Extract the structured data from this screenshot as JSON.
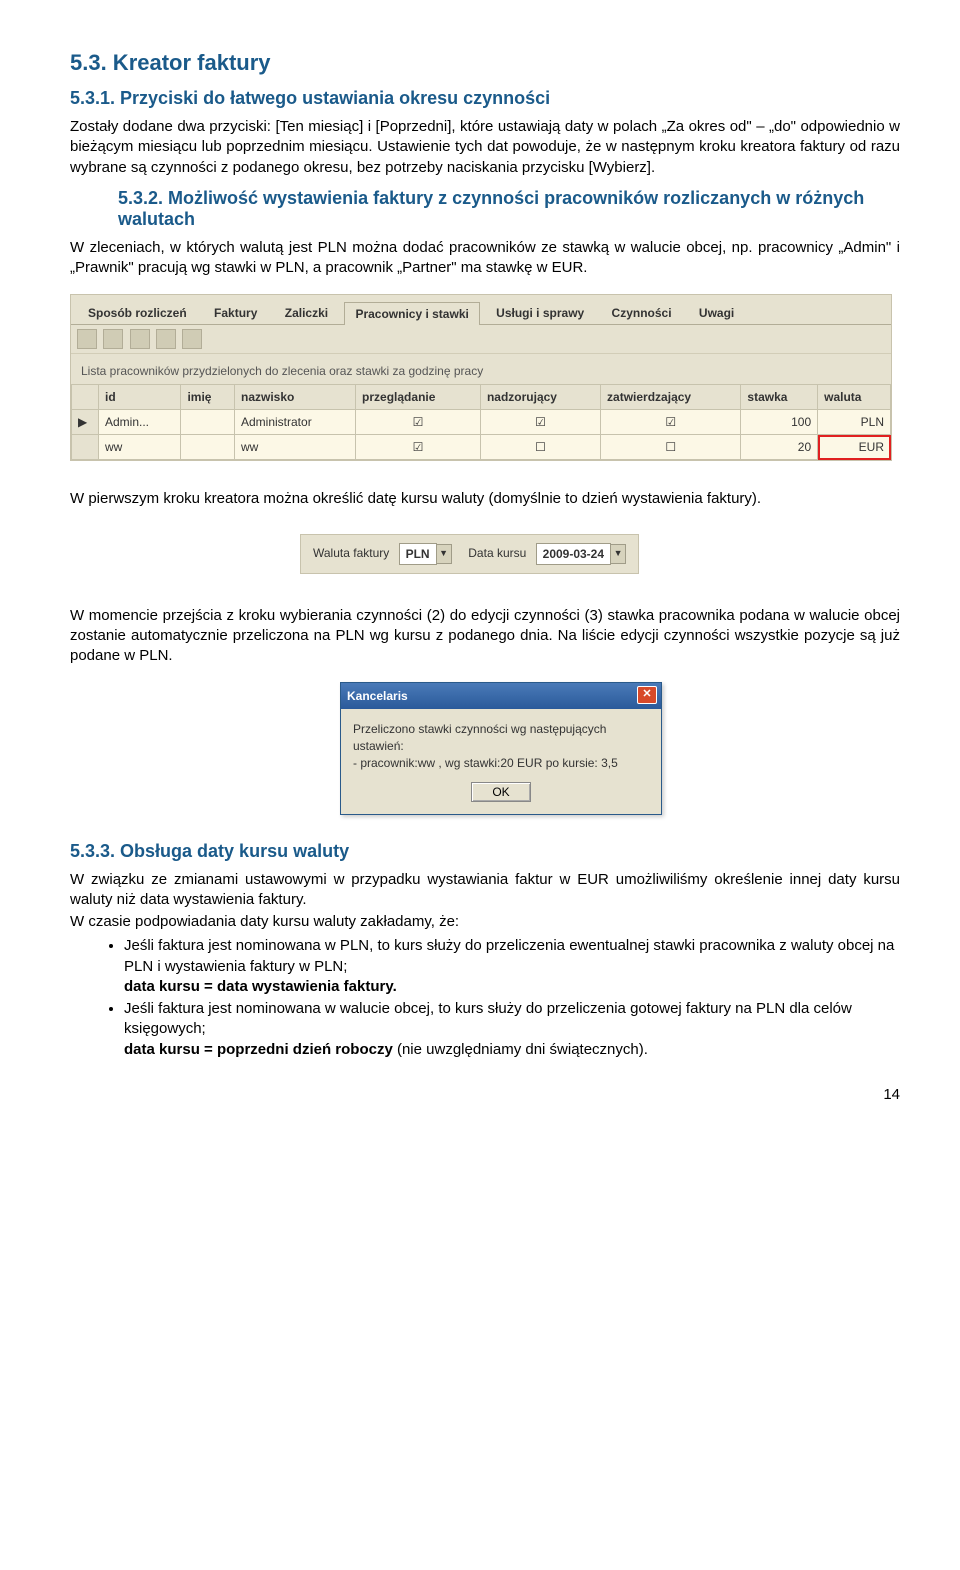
{
  "h_53": "5.3. Kreator faktury",
  "h_531": "5.3.1. Przyciski do łatwego ustawiania okresu czynności",
  "p_531": "Zostały dodane dwa przyciski: [Ten miesiąc] i [Poprzedni], które ustawiają daty w polach „Za okres od\" – „do\" odpowiednio w bieżącym miesiącu lub poprzednim miesiącu. Ustawienie tych dat powoduje, że w następnym kroku kreatora faktury od razu wybrane są czynności z podanego okresu, bez potrzeby naciskania przycisku [Wybierz].",
  "h_532": "5.3.2. Możliwość wystawienia faktury z czynności pracowników rozliczanych w różnych walutach",
  "p_532": "W zleceniach, w których walutą jest PLN można dodać pracowników ze stawką w walucie obcej, np. pracownicy „Admin\" i „Prawnik\" pracują wg stawki w PLN, a pracownik „Partner\" ma stawkę w EUR.",
  "panel1": {
    "tabs": [
      "Sposób rozliczeń",
      "Faktury",
      "Zaliczki",
      "Pracownicy i stawki",
      "Usługi i sprawy",
      "Czynności",
      "Uwagi"
    ],
    "active_tab": 3,
    "caption": "Lista pracowników przydzielonych do zlecenia oraz stawki za godzinę pracy",
    "columns": [
      "id",
      "imię",
      "nazwisko",
      "przeglądanie",
      "nadzorujący",
      "zatwierdzający",
      "stawka",
      "waluta"
    ],
    "rows": [
      {
        "id": "Admin...",
        "imie": "",
        "nazwisko": "Administrator",
        "przeg": true,
        "nadz": true,
        "zatw": true,
        "stawka": "100",
        "waluta": "PLN"
      },
      {
        "id": "ww",
        "imie": "",
        "nazwisko": "ww",
        "przeg": true,
        "nadz": false,
        "zatw": false,
        "stawka": "20",
        "waluta": "EUR"
      }
    ]
  },
  "p_after_panel1": "W pierwszym kroku kreatora można określić datę kursu waluty (domyślnie to dzień wystawienia faktury).",
  "panel2": {
    "label_currency": "Waluta faktury",
    "currency": "PLN",
    "label_date": "Data kursu",
    "date": "2009-03-24"
  },
  "p_after_panel2": "W momencie przejścia z kroku wybierania czynności (2) do edycji czynności (3) stawka pracownika podana w walucie obcej zostanie automatycznie przeliczona na PLN wg kursu z podanego dnia. Na liście edycji czynności wszystkie pozycje są już podane w PLN.",
  "dialog": {
    "title": "Kancelaris",
    "line1": "Przeliczono stawki czynności wg następujących ustawień:",
    "line2": "- pracownik:ww , wg stawki:20 EUR po kursie: 3,5",
    "ok": "OK"
  },
  "h_533": "5.3.3. Obsługa daty kursu waluty",
  "p_533a": "W związku ze zmianami ustawowymi w przypadku wystawiania faktur w EUR umożliwiliśmy określenie innej daty kursu waluty niż data wystawienia faktury.",
  "p_533b": "W czasie podpowiadania daty kursu waluty zakładamy, że:",
  "bullets": [
    {
      "text": "Jeśli faktura jest nominowana w PLN, to kurs służy do przeliczenia ewentualnej stawki pracownika z waluty obcej na PLN i wystawienia faktury w PLN;",
      "bold": "data kursu = data wystawienia faktury."
    },
    {
      "text": "Jeśli faktura jest nominowana w walucie obcej, to kurs służy do przeliczenia gotowej faktury na PLN dla celów księgowych;",
      "bold": "data kursu = poprzedni dzień roboczy",
      "tail": " (nie uwzględniamy dni świątecznych)."
    }
  ],
  "page": "14"
}
